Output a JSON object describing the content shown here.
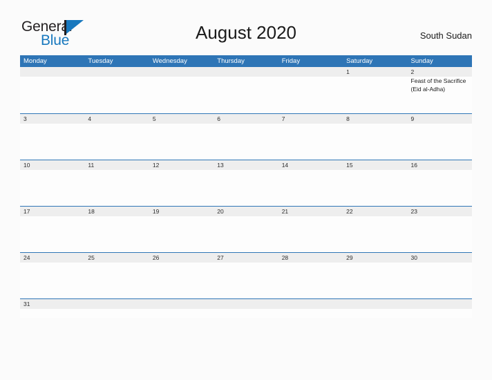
{
  "brand": {
    "name_part1": "General",
    "name_part2": "Blue",
    "flag_icon": "flag-icon",
    "color_dark": "#231f20",
    "color_blue": "#1878be"
  },
  "header": {
    "title": "August 2020",
    "subtitle": "South Sudan"
  },
  "calendar": {
    "header_color": "#2e75b6",
    "numstrip_color": "#eeeeee",
    "weekdays": [
      "Monday",
      "Tuesday",
      "Wednesday",
      "Thursday",
      "Friday",
      "Saturday",
      "Sunday"
    ],
    "weeks": [
      [
        {
          "day": ""
        },
        {
          "day": ""
        },
        {
          "day": ""
        },
        {
          "day": ""
        },
        {
          "day": ""
        },
        {
          "day": "1"
        },
        {
          "day": "2",
          "event": "Feast of the Sacrifice (Eid al-Adha)"
        }
      ],
      [
        {
          "day": "3"
        },
        {
          "day": "4"
        },
        {
          "day": "5"
        },
        {
          "day": "6"
        },
        {
          "day": "7"
        },
        {
          "day": "8"
        },
        {
          "day": "9"
        }
      ],
      [
        {
          "day": "10"
        },
        {
          "day": "11"
        },
        {
          "day": "12"
        },
        {
          "day": "13"
        },
        {
          "day": "14"
        },
        {
          "day": "15"
        },
        {
          "day": "16"
        }
      ],
      [
        {
          "day": "17"
        },
        {
          "day": "18"
        },
        {
          "day": "19"
        },
        {
          "day": "20"
        },
        {
          "day": "21"
        },
        {
          "day": "22"
        },
        {
          "day": "23"
        }
      ],
      [
        {
          "day": "24"
        },
        {
          "day": "25"
        },
        {
          "day": "26"
        },
        {
          "day": "27"
        },
        {
          "day": "28"
        },
        {
          "day": "29"
        },
        {
          "day": "30"
        }
      ],
      [
        {
          "day": "31"
        },
        {
          "day": ""
        },
        {
          "day": ""
        },
        {
          "day": ""
        },
        {
          "day": ""
        },
        {
          "day": ""
        },
        {
          "day": ""
        }
      ]
    ]
  }
}
